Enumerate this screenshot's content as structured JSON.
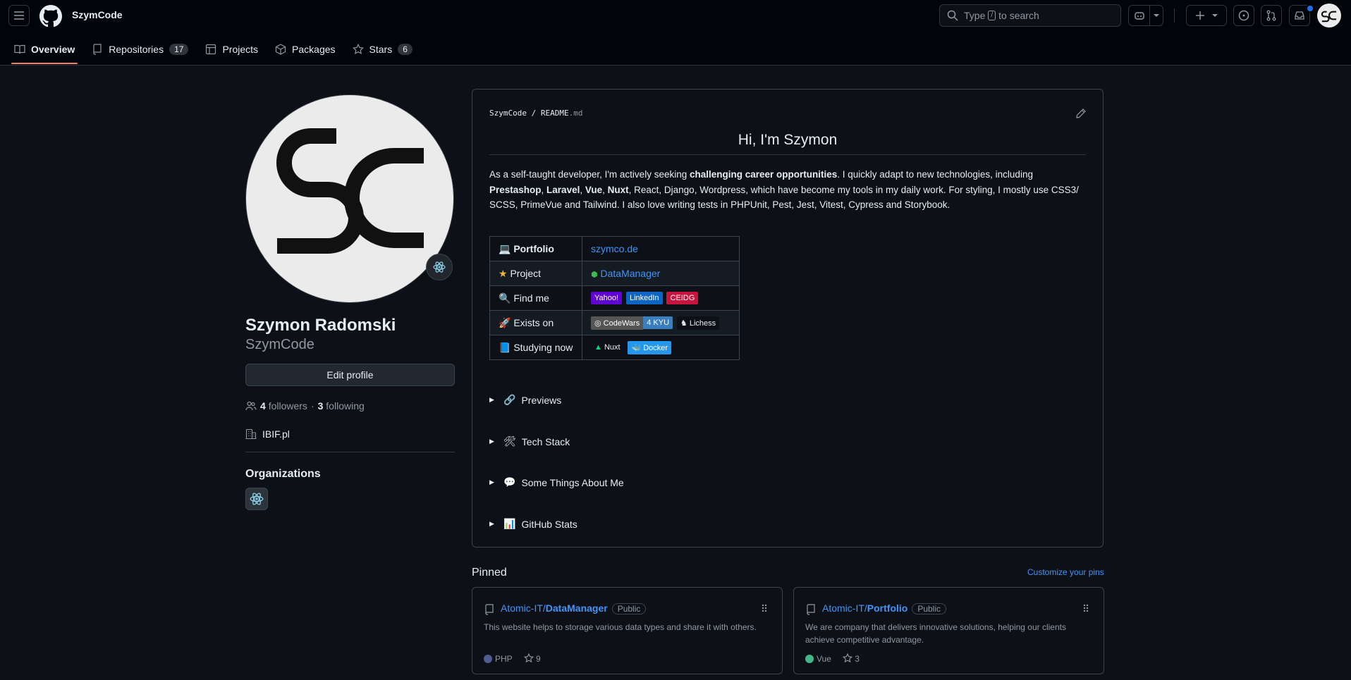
{
  "header": {
    "title": "SzymCode",
    "search_prefix": "Type",
    "search_key": "/",
    "search_suffix": "to search"
  },
  "tabs": [
    {
      "label": "Overview",
      "icon": "book-icon"
    },
    {
      "label": "Repositories",
      "icon": "repo-icon",
      "count": "17"
    },
    {
      "label": "Projects",
      "icon": "table-icon"
    },
    {
      "label": "Packages",
      "icon": "package-icon"
    },
    {
      "label": "Stars",
      "icon": "star-icon",
      "count": "6"
    }
  ],
  "profile": {
    "full_name": "Szymon Radomski",
    "login": "SzymCode",
    "edit_label": "Edit profile",
    "followers_count": "4",
    "followers_label": "followers",
    "following_count": "3",
    "following_label": "following",
    "company": "IBIF.pl",
    "orgs_heading": "Organizations"
  },
  "readme": {
    "path_owner": "SzymCode",
    "path_file": "README",
    "path_ext": ".md",
    "title": "Hi, I'm Szymon",
    "para": {
      "t1": "As a self-taught developer, I'm actively seeking ",
      "b1": "challenging career opportunities",
      "t2": ". I quickly adapt to new technologies, including ",
      "b2": "Prestashop",
      "t3": ", ",
      "b3": "Laravel",
      "t4": ", ",
      "b4": "Vue",
      "t5": ", ",
      "b5": "Nuxt",
      "t6": ", React, Django, Wordpress, which have become my tools in my daily work. For styling, I mostly use CSS3/ SCSS, PrimeVue and Tailwind. I also love writing tests in PHPUnit, Pest, Jest, Vitest, Cypress and Storybook."
    },
    "table": {
      "portfolio_label": "Portfolio",
      "portfolio_link": "szymco.de",
      "project_label": "Project",
      "project_link": "DataManager",
      "findme_label": "Find me",
      "findme_badges": [
        "Yahoo!",
        "LinkedIn",
        "CEIDG"
      ],
      "exists_label": "Exists on",
      "codewars_label": "CodeWars",
      "codewars_rank": "4 KYU",
      "lichess_label": "Lichess",
      "studying_label": "Studying now",
      "nuxt_label": "Nuxt",
      "docker_label": "Docker"
    },
    "details": [
      {
        "label": "Previews",
        "emoji": "🔗"
      },
      {
        "label": "Tech Stack",
        "emoji": "🛠"
      },
      {
        "label": "Some Things About Me",
        "emoji": "💬"
      },
      {
        "label": "GitHub Stats",
        "emoji": "📊"
      }
    ]
  },
  "pinned": {
    "heading": "Pinned",
    "customize": "Customize your pins",
    "cards": [
      {
        "owner": "Atomic-IT/",
        "name": "DataManager",
        "visibility": "Public",
        "desc": "This website helps to storage various data types and share it with others.",
        "language": "PHP",
        "lang_color": "#4F5D95",
        "stars": "9"
      },
      {
        "owner": "Atomic-IT/",
        "name": "Portfolio",
        "visibility": "Public",
        "desc": "We are company that delivers innovative solutions, helping our clients achieve competitive advantage.",
        "language": "Vue",
        "lang_color": "#41b883",
        "stars": "3"
      }
    ]
  },
  "colors": {
    "bg": "#0d1117",
    "accent": "#4493f8",
    "tab_underline": "#f78166"
  }
}
